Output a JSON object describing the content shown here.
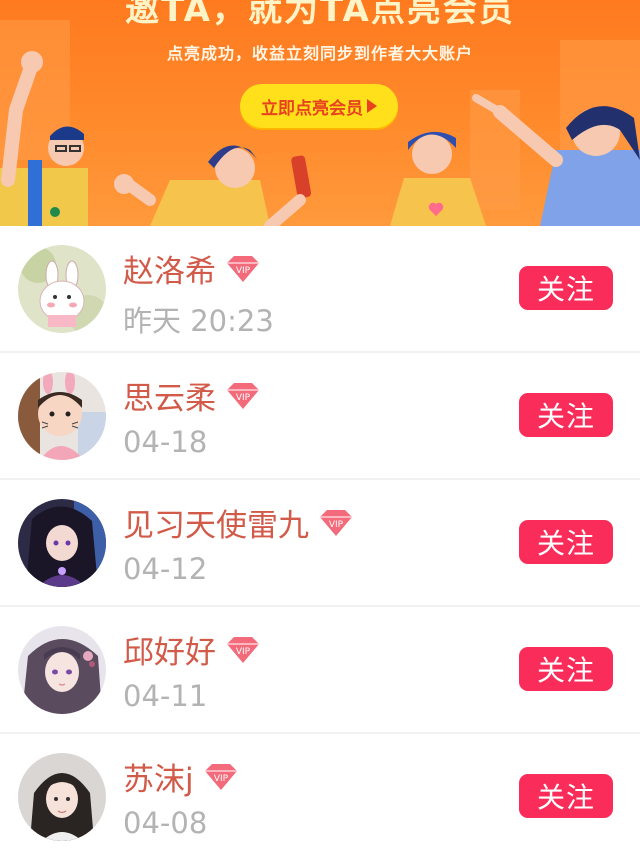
{
  "banner": {
    "title": "邀TA，就为TA点亮会员",
    "subtitle": "点亮成功，收益立刻同步到作者大大账户",
    "cta_label": "立即点亮会员"
  },
  "colors": {
    "banner_bg": "#ff7a1f",
    "cta_bg": "#ffe01a",
    "name": "#d25a48",
    "follow_bg": "#fa2d5a",
    "vip_badge": "#f36a7a"
  },
  "vip_badge_text": "VIP",
  "follow_label": "关注",
  "users": [
    {
      "name": "赵洛希",
      "time": "昨天 20:23",
      "avatar": "bunny-drawing"
    },
    {
      "name": "思云柔",
      "time": "04-18",
      "avatar": "child-bunny-ears"
    },
    {
      "name": "见习天使雷九",
      "time": "04-12",
      "avatar": "anime-dark-character"
    },
    {
      "name": "邱好好",
      "time": "04-11",
      "avatar": "anime-girl"
    },
    {
      "name": "苏沫j",
      "time": "04-08",
      "avatar": "girl-photo"
    }
  ]
}
